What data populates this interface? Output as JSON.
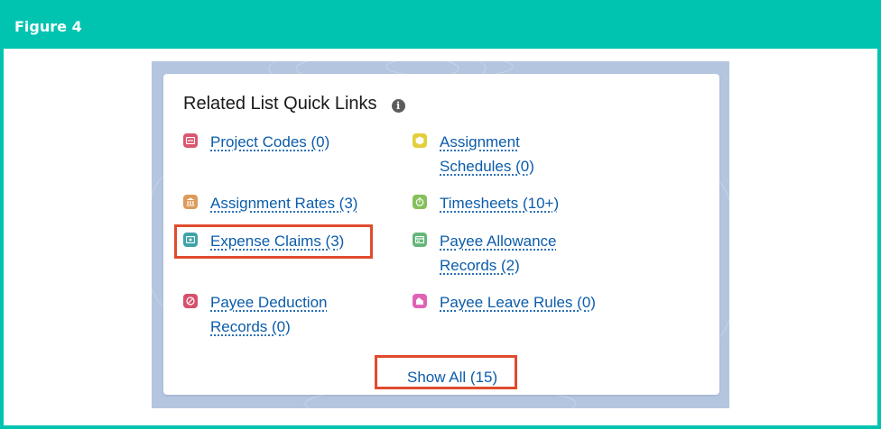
{
  "figure": {
    "title": "Figure 4"
  },
  "card": {
    "title": "Related List Quick Links",
    "info_icon": "info-icon",
    "links": [
      {
        "label": "Project Codes (0)",
        "icon": "project-codes-icon",
        "color": "#d9576f"
      },
      {
        "label": "Assignment Schedules (0)",
        "icon": "assignment-schedules-icon",
        "color": "#e2cf3a"
      },
      {
        "label": "Assignment Rates (3)",
        "icon": "assignment-rates-icon",
        "color": "#dc9b5b"
      },
      {
        "label": "Timesheets (10+)",
        "icon": "timesheets-icon",
        "color": "#86c05b"
      },
      {
        "label": "Expense Claims (3)",
        "icon": "expense-claims-icon",
        "color": "#3ea3a7"
      },
      {
        "label": "Payee Allowance Records (2)",
        "icon": "payee-allowance-records-icon",
        "color": "#65b67a"
      },
      {
        "label": "Payee Deduction Records (0)",
        "icon": "payee-deduction-records-icon",
        "color": "#d6506b"
      },
      {
        "label": "Payee Leave Rules (0)",
        "icon": "payee-leave-rules-icon",
        "color": "#e063b5"
      }
    ],
    "show_all_label": "Show All (15)"
  },
  "colors": {
    "frame": "#00c4b0",
    "link": "#0b5cab",
    "highlight": "#e04b2d",
    "backdrop": "#b4c5e0"
  }
}
